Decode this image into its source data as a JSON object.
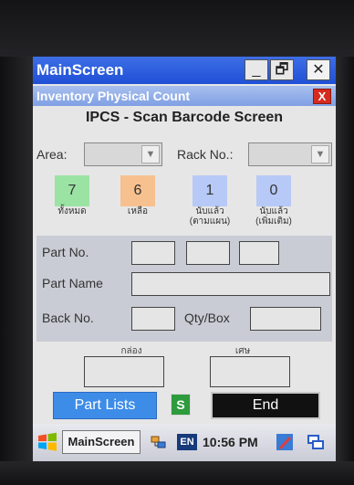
{
  "window": {
    "title": "MainScreen",
    "min_label": "_",
    "max_label": "🗗",
    "close_label": "✕"
  },
  "app": {
    "title": "Inventory Physical Count",
    "close_label": "X"
  },
  "heading": "IPCS - Scan Barcode Screen",
  "filters": {
    "area_label": "Area:",
    "area_value": "",
    "rack_label": "Rack No.:",
    "rack_value": ""
  },
  "counters": [
    {
      "value": "7",
      "label_line1": "ทั้งหมด",
      "label_line2": "",
      "color": "#9be3a3"
    },
    {
      "value": "6",
      "label_line1": "เหลือ",
      "label_line2": "",
      "color": "#f7c08f"
    },
    {
      "value": "1",
      "label_line1": "นับแล้ว",
      "label_line2": "(ตามแผน)",
      "color": "#b7c9f6"
    },
    {
      "value": "0",
      "label_line1": "นับแล้ว",
      "label_line2": "(เพิ่มเติม)",
      "color": "#b7c9f6"
    }
  ],
  "part": {
    "part_no_label": "Part No.",
    "part_name_label": "Part Name",
    "back_no_label": "Back No.",
    "qty_box_label": "Qty/Box"
  },
  "boxes": {
    "box_label": "กล่อง",
    "fraction_label": "เศษ"
  },
  "buttons": {
    "part_lists": "Part Lists",
    "s": "S",
    "end": "End"
  },
  "taskbar": {
    "app_label": "MainScreen",
    "lang": "EN",
    "time": "10:56 PM"
  },
  "icons": {
    "start": "windows-logo-icon",
    "tray1": "network-icon",
    "tray2": "pen-icon",
    "tray3": "window-switch-icon"
  }
}
